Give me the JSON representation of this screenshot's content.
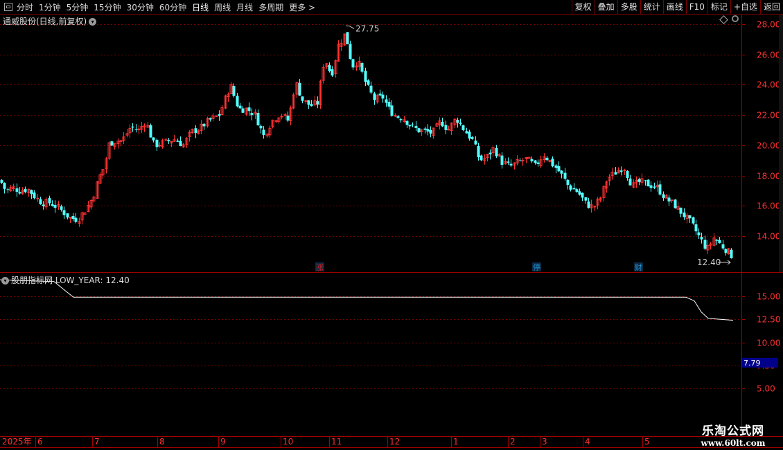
{
  "toolbar": {
    "periods": [
      "分时",
      "1分钟",
      "5分钟",
      "15分钟",
      "30分钟",
      "60分钟",
      "日线",
      "周线",
      "月线",
      "多周期",
      "更多"
    ],
    "active_period": "日线",
    "more_arrow": ">",
    "right_buttons": [
      "复权",
      "叠加",
      "多股",
      "统计",
      "画线",
      "F10",
      "标记",
      "+自选",
      "返回"
    ]
  },
  "main_chart": {
    "title": "通威股份(日线,前复权)",
    "price_ticks": [
      "28.00",
      "26.00",
      "24.00",
      "22.00",
      "20.00",
      "18.00",
      "16.00",
      "14.00"
    ],
    "high_label": "27.75",
    "low_label": "12.40",
    "markers": [
      {
        "text": "涨",
        "color": "#d02020"
      },
      {
        "text": "停",
        "color": "#2090d0"
      },
      {
        "text": "财",
        "color": "#2090d0"
      }
    ],
    "up_color": "#ff3232",
    "down_color": "#54ffff"
  },
  "indicator": {
    "title": "股朋指标网",
    "formula_label": "LOW_YEAR: 12.40",
    "ticks": [
      "15.00",
      "12.50",
      "10.00",
      "7.50",
      "5.00"
    ],
    "current_value": "7.79"
  },
  "time_axis": {
    "year_label": "2025年",
    "months": [
      "6",
      "7",
      "8",
      "9",
      "10",
      "11",
      "12",
      "1",
      "2",
      "3",
      "4",
      "5"
    ]
  },
  "watermark": {
    "line1": "乐淘公式网",
    "line2": "www.60lt.com"
  },
  "chart_data": {
    "type": "candlestick",
    "ylim": [
      12,
      28.5
    ],
    "anchors": [
      [
        0,
        17.7
      ],
      [
        8,
        17.0
      ],
      [
        18,
        17.2
      ],
      [
        28,
        17.0
      ],
      [
        40,
        17.1
      ],
      [
        50,
        16.6
      ],
      [
        60,
        16.2
      ],
      [
        72,
        16.2
      ],
      [
        86,
        15.8
      ],
      [
        100,
        15.2
      ],
      [
        112,
        15.1
      ],
      [
        124,
        15.8
      ],
      [
        134,
        16.6
      ],
      [
        142,
        17.8
      ],
      [
        150,
        18.6
      ],
      [
        157,
        20.1
      ],
      [
        166,
        20.3
      ],
      [
        176,
        20.3
      ],
      [
        188,
        21.2
      ],
      [
        200,
        21.0
      ],
      [
        210,
        21.6
      ],
      [
        222,
        20.0
      ],
      [
        238,
        20.2
      ],
      [
        252,
        20.4
      ],
      [
        264,
        20.0
      ],
      [
        276,
        20.9
      ],
      [
        288,
        21.1
      ],
      [
        300,
        21.6
      ],
      [
        316,
        22.0
      ],
      [
        332,
        24.0
      ],
      [
        344,
        22.4
      ],
      [
        356,
        22.4
      ],
      [
        368,
        22.0
      ],
      [
        380,
        20.6
      ],
      [
        392,
        21.6
      ],
      [
        404,
        22.1
      ],
      [
        416,
        21.6
      ],
      [
        426,
        24.2
      ],
      [
        436,
        23.0
      ],
      [
        448,
        22.6
      ],
      [
        458,
        22.8
      ],
      [
        468,
        25.8
      ],
      [
        478,
        24.6
      ],
      [
        488,
        26.6
      ],
      [
        498,
        27.4
      ],
      [
        508,
        25.2
      ],
      [
        516,
        25.6
      ],
      [
        528,
        24.0
      ],
      [
        540,
        23.0
      ],
      [
        552,
        23.2
      ],
      [
        562,
        22.3
      ],
      [
        572,
        21.9
      ],
      [
        582,
        21.8
      ],
      [
        592,
        21.3
      ],
      [
        602,
        21.0
      ],
      [
        614,
        20.9
      ],
      [
        624,
        20.8
      ],
      [
        636,
        21.6
      ],
      [
        646,
        21.0
      ],
      [
        658,
        21.8
      ],
      [
        670,
        21.0
      ],
      [
        682,
        20.3
      ],
      [
        692,
        19.0
      ],
      [
        702,
        19.2
      ],
      [
        712,
        19.8
      ],
      [
        724,
        18.9
      ],
      [
        736,
        18.6
      ],
      [
        748,
        18.9
      ],
      [
        760,
        19.1
      ],
      [
        772,
        18.6
      ],
      [
        784,
        19.4
      ],
      [
        796,
        18.8
      ],
      [
        808,
        18.2
      ],
      [
        820,
        17.3
      ],
      [
        834,
        16.9
      ],
      [
        846,
        16.1
      ],
      [
        856,
        15.9
      ],
      [
        866,
        16.5
      ],
      [
        876,
        17.8
      ],
      [
        888,
        18.2
      ],
      [
        900,
        18.6
      ],
      [
        912,
        17.3
      ],
      [
        924,
        17.6
      ],
      [
        936,
        17.4
      ],
      [
        948,
        17.2
      ],
      [
        960,
        16.5
      ],
      [
        972,
        16.1
      ],
      [
        984,
        15.5
      ],
      [
        996,
        14.9
      ],
      [
        1008,
        14.0
      ],
      [
        1020,
        13.1
      ],
      [
        1030,
        13.9
      ],
      [
        1040,
        13.4
      ],
      [
        1050,
        13.0
      ],
      [
        1058,
        12.6
      ]
    ],
    "low_year": [
      [
        0,
        16.8
      ],
      [
        78,
        16.6
      ],
      [
        96,
        15.5
      ],
      [
        106,
        14.9
      ],
      [
        990,
        14.9
      ],
      [
        1002,
        14.5
      ],
      [
        1012,
        13.3
      ],
      [
        1022,
        12.6
      ],
      [
        1058,
        12.4
      ]
    ],
    "indicator_ylim": [
      2.5,
      17.5
    ]
  }
}
